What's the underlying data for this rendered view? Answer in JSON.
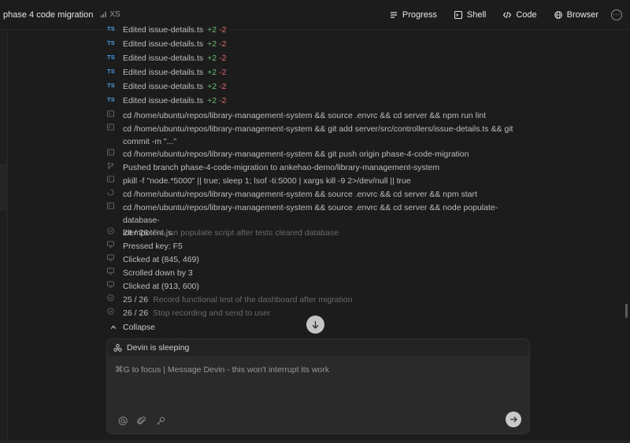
{
  "header": {
    "title": "phase 4 code migration",
    "size_badge": "XS",
    "tabs": [
      {
        "label": "Progress",
        "icon": "progress-icon"
      },
      {
        "label": "Shell",
        "icon": "terminal-icon"
      },
      {
        "label": "Code",
        "icon": "code-icon"
      },
      {
        "label": "Browser",
        "icon": "globe-icon"
      }
    ]
  },
  "feed": {
    "edits": [
      {
        "badge": "TS",
        "text": "Edited issue-details.ts",
        "added": "+2",
        "removed": "-2"
      },
      {
        "badge": "TS",
        "text": "Edited issue-details.ts",
        "added": "+2",
        "removed": "-2"
      },
      {
        "badge": "TS",
        "text": "Edited issue-details.ts",
        "added": "+2",
        "removed": "-2"
      },
      {
        "badge": "TS",
        "text": "Edited issue-details.ts",
        "added": "+2",
        "removed": "-2"
      },
      {
        "badge": "TS",
        "text": "Edited issue-details.ts",
        "added": "+2",
        "removed": "-2"
      },
      {
        "badge": "TS",
        "text": "Edited issue-details.ts",
        "added": "+2",
        "removed": "-2"
      }
    ],
    "commands": {
      "c1": "cd /home/ubuntu/repos/library-management-system && source .envrc && cd server && npm run lint",
      "c2a": "cd /home/ubuntu/repos/library-management-system && git add server/src/controllers/issue-details.ts && git",
      "c2b": "commit -m \"...\"",
      "c3": "cd /home/ubuntu/repos/library-management-system && git push origin phase-4-code-migration",
      "c4": "Pushed branch phase-4-code-migration to ankehao-demo/library-management-system",
      "c5": "pkill -f \"node.*5000\" || true; sleep 1; lsof -ti:5000 | xargs kill -9 2>/dev/null || true",
      "c6": "cd /home/ubuntu/repos/library-management-system && source .envrc && cd server && npm start",
      "c7a": "cd /home/ubuntu/repos/library-management-system && source .envrc && cd server && node populate-database-",
      "c7b": "idempotent.js"
    },
    "step24": {
      "num": "24 / 26",
      "desc": "Re-run populate script after tests cleared database"
    },
    "browser_actions": {
      "a1": "Pressed key: F5",
      "a2": "Clicked at (845, 469)",
      "a3": "Scrolled down by 3",
      "a4": "Clicked at (913, 600)"
    },
    "step25": {
      "num": "25 / 26",
      "desc": "Record functional test of the dashboard after migration"
    },
    "step26": {
      "num": "26 / 26",
      "desc": "Stop recording and send to user"
    },
    "collapse_label": "Collapse"
  },
  "composer": {
    "status": "Devin is sleeping",
    "placeholder": "⌘G to focus | Message Devin - this won't interrupt its work"
  },
  "colors": {
    "background": "#1c1c1c",
    "added": "#6fbf73",
    "removed": "#e06c6c",
    "ts_badge": "#4d9de0"
  }
}
